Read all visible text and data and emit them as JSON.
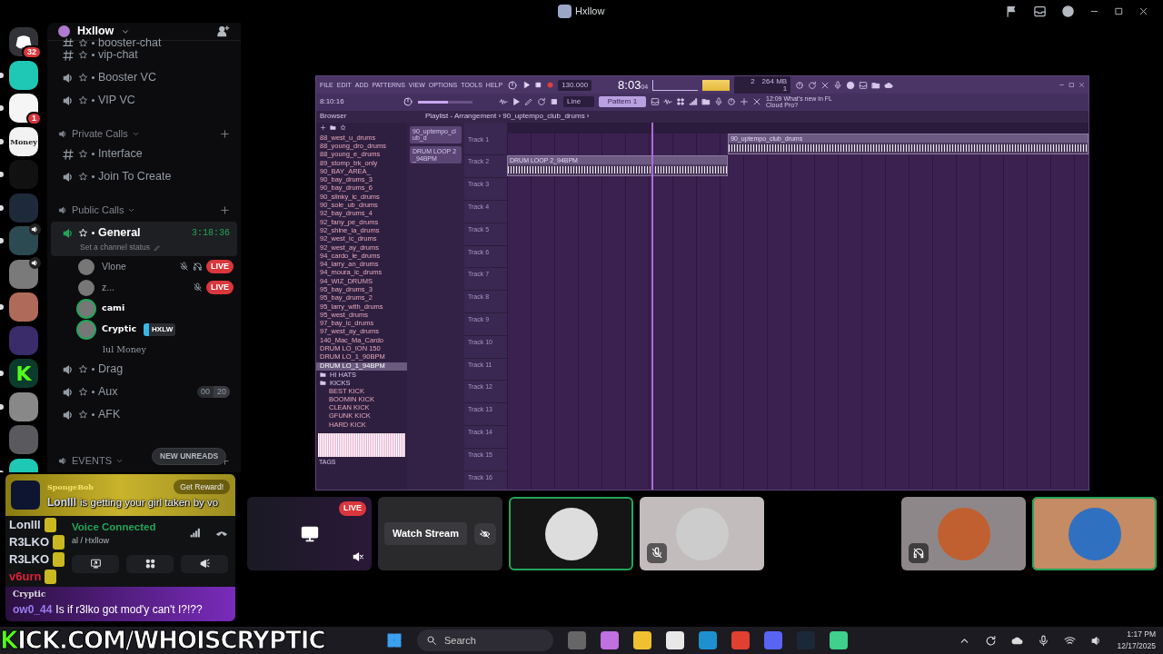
{
  "title_bar": {
    "title": "Hxllow"
  },
  "server_rail": [
    {
      "kind": "home",
      "badge": "32",
      "unread": false,
      "in_voice": false
    },
    {
      "kind": "image",
      "unread": true,
      "in_voice": false
    },
    {
      "kind": "image",
      "badge": "1",
      "unread": true,
      "in_voice": false
    },
    {
      "kind": "text",
      "label": "Money",
      "unread": true,
      "in_voice": false
    },
    {
      "kind": "image",
      "unread": true,
      "in_voice": false
    },
    {
      "kind": "image",
      "unread": true,
      "in_voice": false
    },
    {
      "kind": "image",
      "unread": true,
      "in_voice": true
    },
    {
      "kind": "image",
      "unread": false,
      "in_voice": true
    },
    {
      "kind": "image",
      "unread": true,
      "in_voice": false
    },
    {
      "kind": "image",
      "unread": false,
      "in_voice": false
    },
    {
      "kind": "text",
      "label": "K",
      "unread": true,
      "in_voice": false
    },
    {
      "kind": "image",
      "unread": true,
      "in_voice": false
    },
    {
      "kind": "image",
      "unread": false,
      "in_voice": false
    },
    {
      "kind": "image",
      "unread": true,
      "in_voice": false
    }
  ],
  "server": {
    "name": "Hxllow"
  },
  "channels": [
    {
      "kind": "text",
      "name": "booster-chat",
      "selected": false
    },
    {
      "kind": "text",
      "name": "vip-chat",
      "selected": false
    },
    {
      "kind": "voice",
      "name": "Booster VC",
      "selected": false
    },
    {
      "kind": "voice",
      "name": "VIP VC",
      "selected": false
    },
    {
      "kind": "category",
      "name": "Private Calls"
    },
    {
      "kind": "text",
      "name": "Interface",
      "selected": false
    },
    {
      "kind": "voice",
      "name": "Join To Create",
      "selected": false
    },
    {
      "kind": "category",
      "name": "Public Calls"
    },
    {
      "kind": "voice",
      "name": "General",
      "selected": true,
      "timer": "3:18:36",
      "status": "Set a channel status",
      "members": [
        {
          "name": "Vlone",
          "live_badge": "LIVE",
          "muted": true,
          "deafened": true,
          "speaking": false
        },
        {
          "name": "z...",
          "live_badge": "LIVE",
          "muted": true,
          "deafened": false,
          "speaking": false
        },
        {
          "name": "cami",
          "muted": false,
          "deafened": false,
          "speaking": true
        },
        {
          "name": "Cryptic",
          "tag": "HXLW",
          "muted": false,
          "deafened": false,
          "speaking": true,
          "activity": "lul Money"
        }
      ]
    },
    {
      "kind": "voice",
      "name": "Drag",
      "selected": false
    },
    {
      "kind": "voice",
      "name": "Aux",
      "selected": false,
      "limit": [
        "00",
        "20"
      ]
    },
    {
      "kind": "voice",
      "name": "AFK",
      "selected": false
    },
    {
      "kind": "category",
      "name": "EVENTS"
    }
  ],
  "new_unreads": "NEW UNREADS",
  "overlay_chat": {
    "banner_title": "SpongeBob",
    "reward_button": "Get Reward!",
    "banner_user": "Lonlll",
    "banner_message": "is getting your girl taken by vo",
    "names": [
      {
        "name": "Lonlll",
        "color": "#d6dbe8"
      },
      {
        "name": "R3LKO",
        "color": "#d6dbe8"
      },
      {
        "name": "R3LKO",
        "color": "#d6dbe8"
      },
      {
        "name": "v6urn",
        "color": "#e0203a"
      }
    ],
    "last_title": "Cryptic",
    "last_user": "ow0_44",
    "last_message": "Is if r3lko got mod'y can't I?!??"
  },
  "voice_panel": {
    "status": "Voice Connected",
    "channel": "al / Hxllow"
  },
  "stream_banner": {
    "logo": "K",
    "text": "ICK.COM/WHOISCRYPTIC"
  },
  "fl_studio": {
    "menu": [
      "FILE",
      "EDIT",
      "ADD",
      "PATTERNS",
      "VIEW",
      "OPTIONS",
      "TOOLS",
      "HELP"
    ],
    "tempo": "130.000",
    "time": "8:03",
    "time_small": "04",
    "memory": "264 MB",
    "cpu": "2",
    "polyphony": "1",
    "song_time": "8:10:16",
    "snap": "Line",
    "pattern": "Pattern 1",
    "hint": "12:09 What's new in FL Cloud Pro?",
    "browser_title": "Browser",
    "playlist_title": "Playlist - Arrangement › 90_uptempo_club_drums ›",
    "browser_items": [
      "88_west_u_drums",
      "88_young_dro_drums",
      "88_young_e_drums",
      "89_stomp_trk_only",
      "90_BAY_AREA_",
      "90_bay_drums_3",
      "90_bay_drums_6",
      "90_slinky_ic_drums",
      "90_sole_ub_drums",
      "92_bay_drums_4",
      "92_fany_pe_drums",
      "92_shine_ia_drums",
      "92_west_ic_drums",
      "92_west_ay_drums",
      "94_cardo_le_drums",
      "94_larry_an_drums",
      "94_moura_ic_drums",
      "94_WIZ_DRUMS",
      "95_bay_drums_3",
      "95_bay_drums_2",
      "95_larry_with_drums",
      "95_west_drums",
      "97_bay_ic_drums",
      "97_west_ay_drums",
      "140_Mac_Ma_Cardo",
      "DRUM LO_ION 150",
      "DRUM LO_1_90BPM",
      "DRUM LO_1_94BPM"
    ],
    "folders": [
      {
        "name": "HI HATS"
      },
      {
        "name": "KICKS",
        "children": [
          "BEST KICK",
          "BOOMIN KICK",
          "CLEAN KICK",
          "GFUNK KICK",
          "HARD KICK"
        ]
      }
    ],
    "tags_label": "TAGS",
    "master_slider": {
      "level": 0.55
    },
    "channel_rack": [
      "90_uptempo_club_d",
      "DRUM LOOP 2_94BPM"
    ],
    "tracks": [
      {
        "name": "Track 1",
        "clip": "90_uptempo_club_drums"
      },
      {
        "name": "Track 2",
        "clip": "DRUM LOOP 2_94BPM"
      },
      {
        "name": "Track 3"
      },
      {
        "name": "Track 4"
      },
      {
        "name": "Track 5"
      },
      {
        "name": "Track 6"
      },
      {
        "name": "Track 7"
      },
      {
        "name": "Track 8"
      },
      {
        "name": "Track 9"
      },
      {
        "name": "Track 10"
      },
      {
        "name": "Track 11"
      },
      {
        "name": "Track 12"
      },
      {
        "name": "Track 13"
      },
      {
        "name": "Track 14"
      },
      {
        "name": "Track 15"
      },
      {
        "name": "Track 16"
      }
    ]
  },
  "tiles": [
    {
      "kind": "stream",
      "live_badge": "LIVE"
    },
    {
      "kind": "watch",
      "button": "Watch Stream"
    },
    {
      "kind": "avatar",
      "speaking": true,
      "muted": false,
      "deafened": false
    },
    {
      "kind": "avatar",
      "speaking": false,
      "muted": true,
      "deafened": false
    },
    {
      "kind": "empty"
    },
    {
      "kind": "avatar",
      "speaking": false,
      "muted": false,
      "deafened": true
    },
    {
      "kind": "avatar",
      "speaking": true,
      "muted": false,
      "deafened": false
    }
  ],
  "taskbar": {
    "search_placeholder": "Search",
    "time": "1:17 PM",
    "date": "12/17/2025"
  }
}
